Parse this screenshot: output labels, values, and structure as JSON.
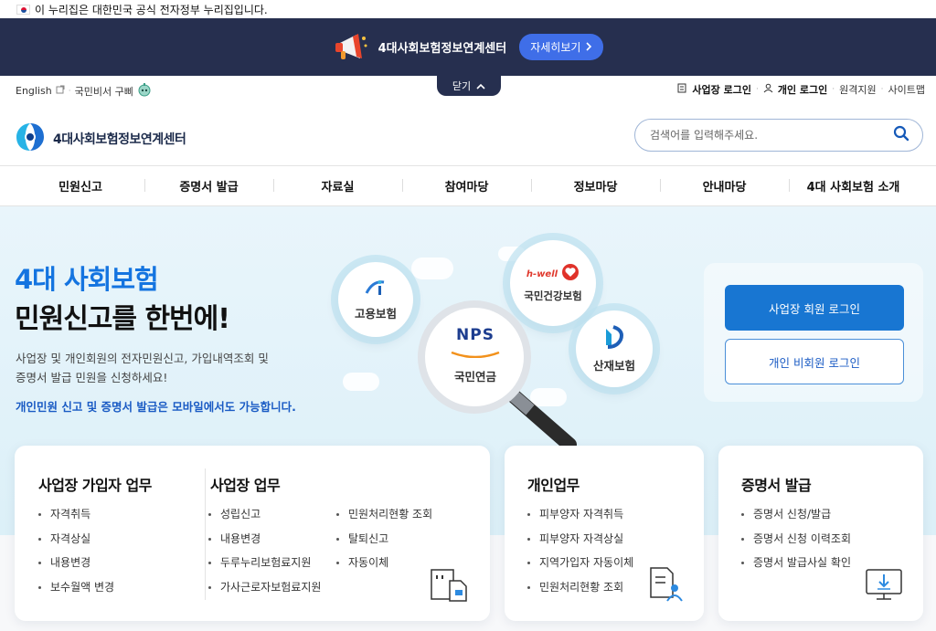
{
  "gov_notice": "이 누리집은 대한민국 공식 전자정부 누리집입니다.",
  "banner": {
    "text": "4대사회보험정보연계센터",
    "button": "자세히보기",
    "close": "닫기"
  },
  "utility": {
    "english": "English",
    "secretary": "국민비서 구삐",
    "biz_login": "사업장 로그인",
    "personal_login": "개인 로그인",
    "remote_support": "원격지원",
    "sitemap": "사이트맵"
  },
  "logo_text": "4대사회보험정보연계센터",
  "search": {
    "placeholder": "검색어를 입력해주세요."
  },
  "gnb": [
    "민원신고",
    "증명서 발급",
    "자료실",
    "참여마당",
    "정보마당",
    "안내마당",
    "4대 사회보험 소개"
  ],
  "hero": {
    "title_line1": "4대 사회보험",
    "title_line2": "민원신고를 한번에!",
    "desc_line1": "사업장 및 개인회원의 전자민원신고, 가입내역조회 및",
    "desc_line2": "증명서 발급 민원을 신청하세요!",
    "mobile_note": "개인민원 신고 및 증명서 발급은 모바일에서도 가능합니다."
  },
  "insurers": {
    "employment": "고용보험",
    "health": "국민건강보험",
    "health_brand": "h-well",
    "pension": "국민연금",
    "pension_brand": "NPS",
    "industrial": "산재보험"
  },
  "login_panel": {
    "biz_member": "사업장 회원 로그인",
    "personal_guest": "개인 비회원 로그인"
  },
  "cards": {
    "biz_subscriber": {
      "title": "사업장 가입자 업무",
      "items": [
        "자격취득",
        "자격상실",
        "내용변경",
        "보수월액 변경"
      ]
    },
    "biz_work": {
      "title": "사업장 업무",
      "items_left": [
        "성립신고",
        "내용변경",
        "두루누리보험료지원",
        "가사근로자보험료지원"
      ],
      "items_right": [
        "민원처리현황 조회",
        "탈퇴신고",
        "자동이체"
      ]
    },
    "personal": {
      "title": "개인업무",
      "items": [
        "피부양자 자격취득",
        "피부양자 자격상실",
        "지역가입자 자동이체",
        "민원처리현황 조회"
      ]
    },
    "certificate": {
      "title": "증명서 발급",
      "items": [
        "증명서 신청/발급",
        "증명서 신청 이력조회",
        "증명서 발급사실 확인"
      ]
    }
  }
}
